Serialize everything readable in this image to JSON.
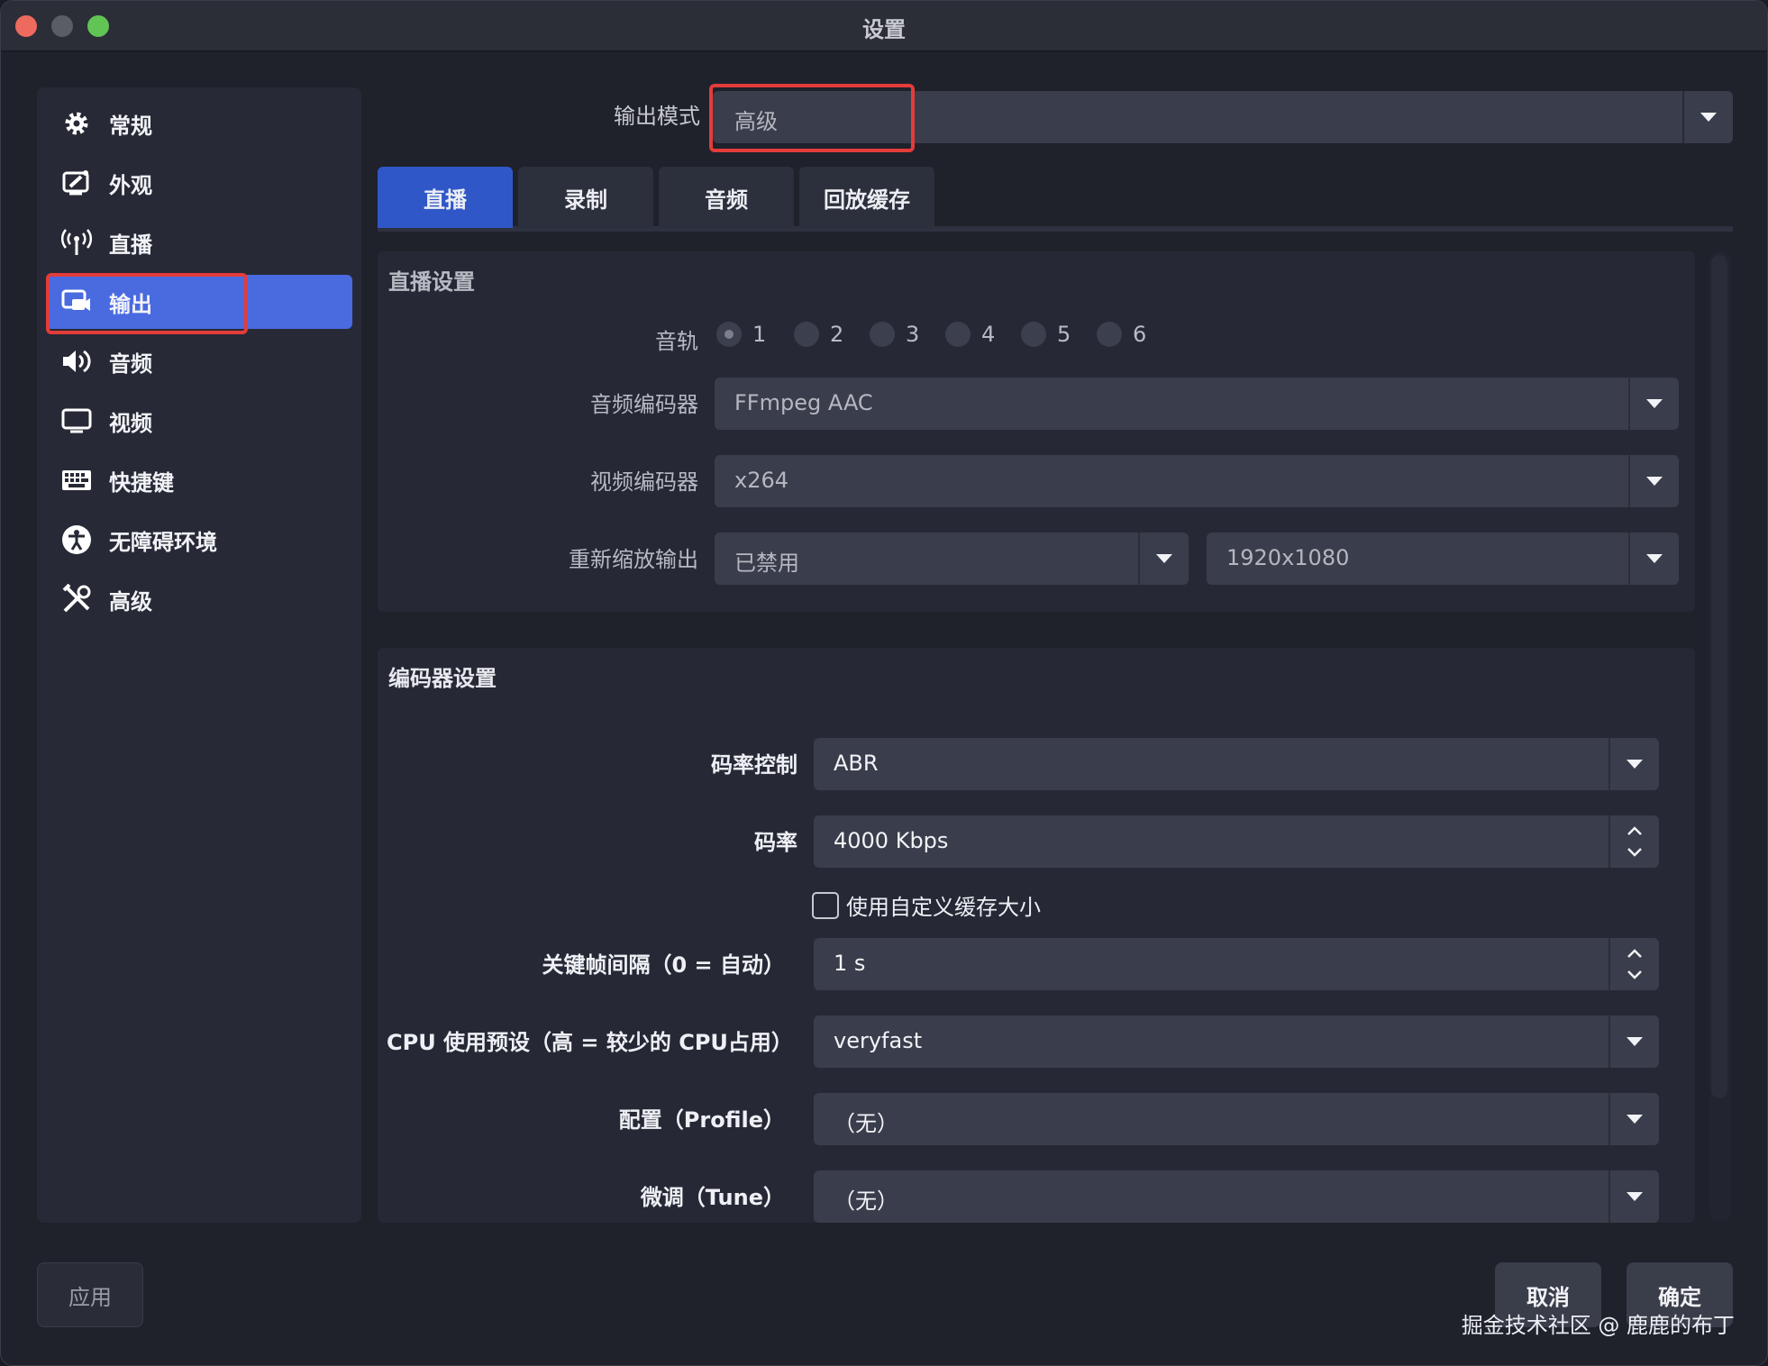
{
  "window": {
    "title": "设置"
  },
  "sidebar": {
    "items": [
      {
        "label": "常规",
        "icon": "gear-icon"
      },
      {
        "label": "外观",
        "icon": "appearance-icon"
      },
      {
        "label": "直播",
        "icon": "antenna-icon"
      },
      {
        "label": "输出",
        "icon": "output-icon",
        "active": true
      },
      {
        "label": "音频",
        "icon": "speaker-icon"
      },
      {
        "label": "视频",
        "icon": "monitor-icon"
      },
      {
        "label": "快捷键",
        "icon": "keyboard-icon"
      },
      {
        "label": "无障碍环境",
        "icon": "accessibility-icon"
      },
      {
        "label": "高级",
        "icon": "tools-icon"
      }
    ]
  },
  "output_mode": {
    "label": "输出模式",
    "value": "高级"
  },
  "tabs": [
    {
      "label": "直播",
      "active": true
    },
    {
      "label": "录制"
    },
    {
      "label": "音频"
    },
    {
      "label": "回放缓存"
    }
  ],
  "stream_settings": {
    "title": "直播设置",
    "audio_track_label": "音轨",
    "tracks": [
      "1",
      "2",
      "3",
      "4",
      "5",
      "6"
    ],
    "selected_track": "1",
    "audio_encoder_label": "音频编码器",
    "audio_encoder": "FFmpeg AAC",
    "video_encoder_label": "视频编码器",
    "video_encoder": "x264",
    "rescale_label": "重新缩放输出",
    "rescale_value": "已禁用",
    "rescale_resolution": "1920x1080"
  },
  "encoder_settings": {
    "title": "编码器设置",
    "rate_control_label": "码率控制",
    "rate_control": "ABR",
    "bitrate_label": "码率",
    "bitrate": "4000 Kbps",
    "custom_buffer_label": "使用自定义缓存大小",
    "custom_buffer_checked": false,
    "keyframe_label": "关键帧间隔（0 = 自动）",
    "keyframe": "1 s",
    "cpu_preset_label": "CPU 使用预设（高 = 较少的 CPU占用）",
    "cpu_preset": "veryfast",
    "profile_label": "配置（Profile）",
    "profile": "（无）",
    "tune_label": "微调（Tune）",
    "tune": "（无）"
  },
  "buttons": {
    "apply": "应用",
    "cancel": "取消",
    "ok": "确定"
  },
  "watermark": "掘金技术社区 @ 鹿鹿的布丁",
  "colors": {
    "accent": "#2f57c8",
    "sidebar_active": "#4a6ae0",
    "highlight": "#e33c3a"
  }
}
